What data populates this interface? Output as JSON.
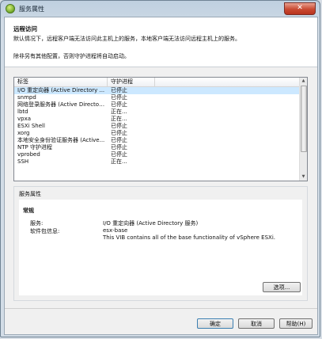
{
  "window": {
    "title": "服务属性",
    "close_glyph": "✕"
  },
  "header": {
    "title": "远程访问",
    "description": "默认情况下，远程客户端无法访问此主机上的服务，本地客户端无法访问远程主机上的服务。",
    "note": "除非另有其他配置，否则守护进程将自动启动。"
  },
  "grid": {
    "columns": [
      "标签",
      "守护进程"
    ],
    "rows": [
      {
        "label": "I/O 重定向器 (Active Directory ...",
        "status": "已停止",
        "selected": true
      },
      {
        "label": "snmpd",
        "status": "已停止"
      },
      {
        "label": "网络登录服务器 (Active Directory ...",
        "status": "已停止"
      },
      {
        "label": "lbtd",
        "status": "正在..."
      },
      {
        "label": "vpxa",
        "status": "正在..."
      },
      {
        "label": "ESXi Shell",
        "status": "已停止"
      },
      {
        "label": "xorg",
        "status": "已停止"
      },
      {
        "label": "本地安全身份验证服务器 (Active...",
        "status": "已停止"
      },
      {
        "label": "NTP 守护进程",
        "status": "已停止"
      },
      {
        "label": "vprobed",
        "status": "已停止"
      },
      {
        "label": "SSH",
        "status": "正在..."
      }
    ]
  },
  "properties": {
    "group_label": "服务属性",
    "section": "常规",
    "service_key": "服务:",
    "service_value": "I/O 重定向器 (Active Directory 服务)",
    "package_key": "软件包信息:",
    "package_name": "esx-base",
    "package_desc": "This VIB contains all of the base functionality of vSphere ESXi.",
    "options_button": "选项..."
  },
  "buttons": {
    "ok": "确定",
    "cancel": "取消",
    "help": "帮助(H)"
  },
  "colors": {
    "selection": "#cce8ff",
    "close_button": "#c94a31",
    "accent": "#3c7fb1"
  }
}
